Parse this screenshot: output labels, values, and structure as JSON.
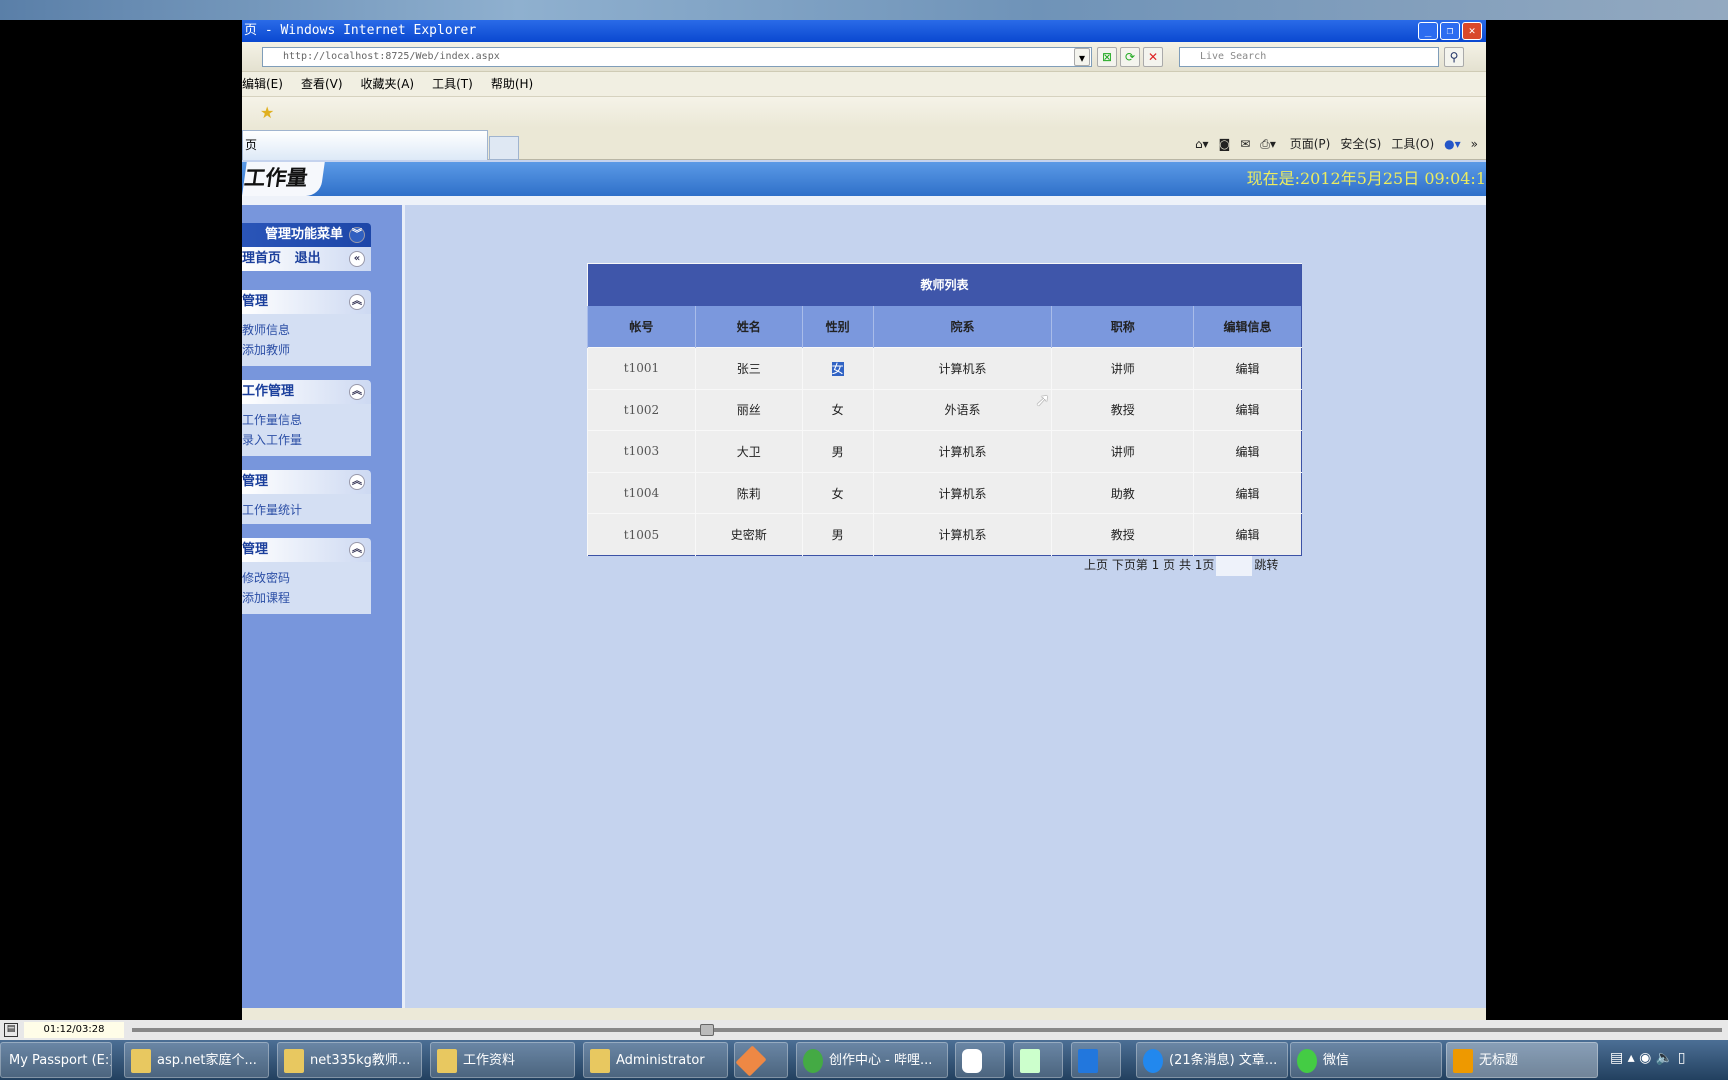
{
  "browser": {
    "title": "页 - Windows Internet Explorer",
    "url": "http://localhost:8725/Web/index.aspx",
    "search_placeholder": "Live Search",
    "menu": [
      "编辑(E)",
      "查看(V)",
      "收藏夹(A)",
      "工具(T)",
      "帮助(H)"
    ],
    "tab_label": "页",
    "commands": [
      "页面(P)",
      "安全(S)",
      "工具(O)"
    ]
  },
  "header": {
    "title": "工作量",
    "clock": "现在是:2012年5月25日 09:04:1"
  },
  "sidebar": {
    "menu_title": "管理功能菜单",
    "home": "理首页",
    "logout": "退出",
    "panels": [
      {
        "title": "管理",
        "items": [
          "教师信息",
          "添加教师"
        ]
      },
      {
        "title": "工作管理",
        "items": [
          "工作量信息",
          "录入工作量"
        ]
      },
      {
        "title": "管理",
        "items": [
          "工作量统计"
        ]
      },
      {
        "title": "管理",
        "items": [
          "修改密码",
          "添加课程"
        ]
      }
    ]
  },
  "table": {
    "caption": "教师列表",
    "columns": [
      "帐号",
      "姓名",
      "性别",
      "院系",
      "职称",
      "编辑信息"
    ],
    "rows": [
      [
        "t1001",
        "张三",
        "女",
        "计算机系",
        "讲师",
        "编辑"
      ],
      [
        "t1002",
        "丽丝",
        "女",
        "外语系",
        "教授",
        "编辑"
      ],
      [
        "t1003",
        "大卫",
        "男",
        "计算机系",
        "讲师",
        "编辑"
      ],
      [
        "t1004",
        "陈莉",
        "女",
        "计算机系",
        "助教",
        "编辑"
      ],
      [
        "t1005",
        "史密斯",
        "男",
        "计算机系",
        "教授",
        "编辑"
      ]
    ]
  },
  "pager": {
    "prev": "上页",
    "next": "下页",
    "info": "第 1 页 共 1页",
    "go": "跳转"
  },
  "player": {
    "time": "01:12/03:28"
  },
  "taskbar": [
    "My Passport (E:)",
    "asp.net家庭个...",
    "net335kg教师...",
    "工作资料",
    "Administrator",
    "创作中心 - 哔哩...",
    "(21条消息) 文章...",
    "微信",
    "无标题"
  ]
}
